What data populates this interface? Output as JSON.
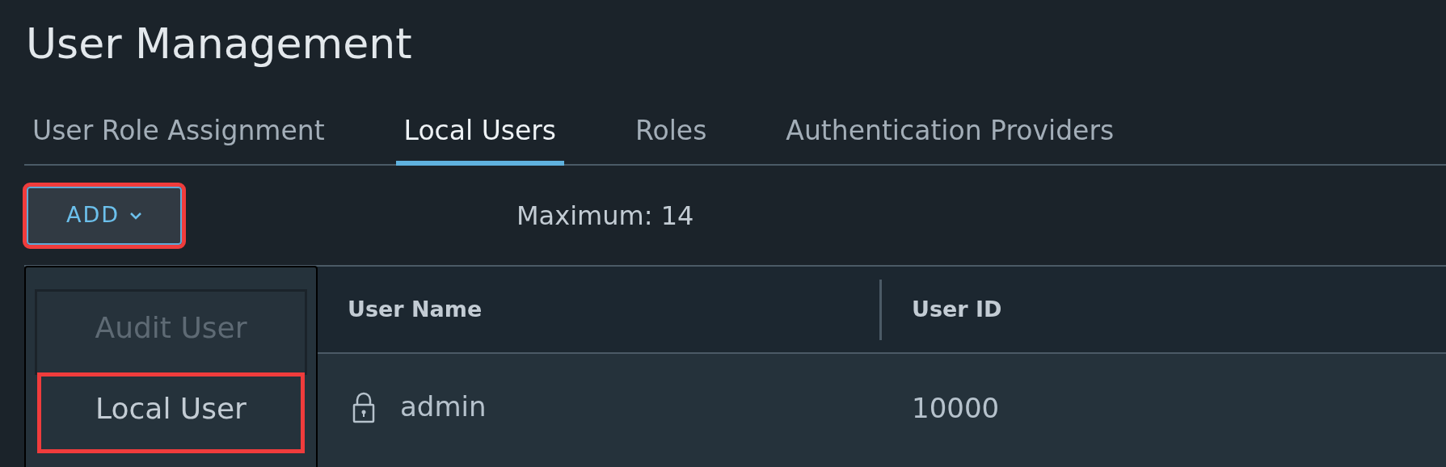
{
  "title": "User Management",
  "tabs": [
    {
      "label": "User Role Assignment",
      "selected": false
    },
    {
      "label": "Local Users",
      "selected": true
    },
    {
      "label": "Roles",
      "selected": false
    },
    {
      "label": "Authentication Providers",
      "selected": false
    }
  ],
  "add_button": {
    "label": "ADD",
    "highlighted": true
  },
  "maximum": "Maximum: 14",
  "menu": [
    {
      "label": "Audit User",
      "disabled": true,
      "highlighted": false
    },
    {
      "label": "Local User",
      "disabled": false,
      "highlighted": true
    }
  ],
  "table": {
    "columns": [
      "User Name",
      "User ID"
    ],
    "rows": [
      {
        "user_name": "admin",
        "user_id": "10000",
        "locked": true
      }
    ]
  }
}
